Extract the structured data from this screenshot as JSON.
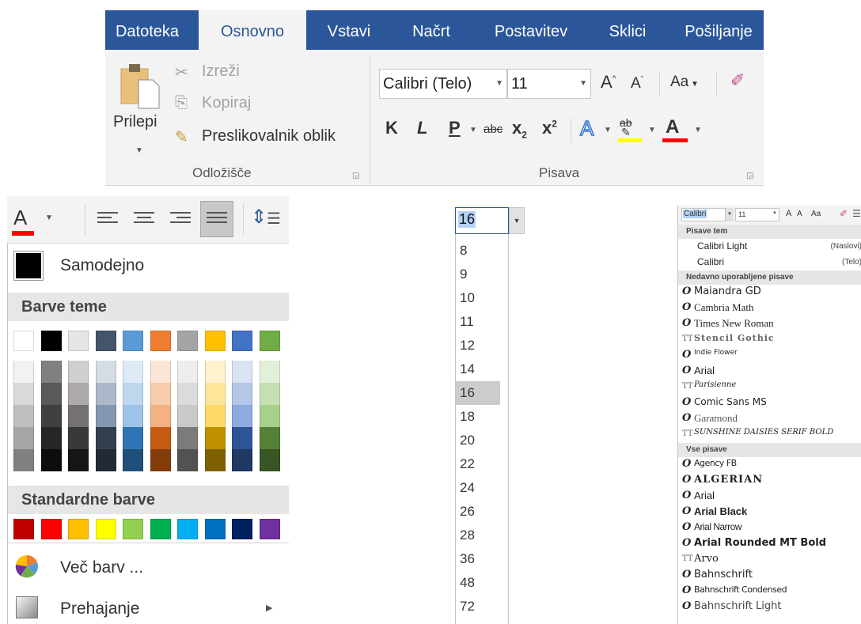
{
  "ribbon": {
    "tabs": [
      "Datoteka",
      "Osnovno",
      "Vstavi",
      "Načrt",
      "Postavitev",
      "Sklici",
      "Pošiljanje"
    ],
    "active_tab": "Osnovno",
    "clipboard": {
      "paste": "Prilepi",
      "cut": "Izreži",
      "copy": "Kopiraj",
      "format_painter": "Preslikovalnik oblik",
      "group_label": "Odložišče"
    },
    "font": {
      "font_name": "Calibri (Telo)",
      "font_size": "11",
      "grow": "A",
      "shrink": "A",
      "change_case": "Aa",
      "bold": "K",
      "italic": "L",
      "underline": "P",
      "strike": "abc",
      "subscript": "x",
      "superscript": "x",
      "sub_mark": "2",
      "sup_mark": "2",
      "text_effects": "A",
      "highlight": "ab",
      "font_color": "A",
      "group_label": "Pisava"
    }
  },
  "color_picker": {
    "automatic": "Samodejno",
    "theme_header": "Barve teme",
    "standard_header": "Standardne barve",
    "more_colors": "Več barv ...",
    "gradient": "Prehajanje",
    "font_color_letter": "A",
    "theme_top": [
      "#ffffff",
      "#000000",
      "#e7e6e6",
      "#44546a",
      "#5b9bd5",
      "#ed7d31",
      "#a5a5a5",
      "#ffc000",
      "#4472c4",
      "#70ad47"
    ],
    "theme_shades": [
      [
        "#f2f2f2",
        "#d9d9d9",
        "#bfbfbf",
        "#a6a6a6",
        "#808080"
      ],
      [
        "#808080",
        "#595959",
        "#404040",
        "#262626",
        "#0d0d0d"
      ],
      [
        "#d0cece",
        "#aeaaaa",
        "#757171",
        "#3a3838",
        "#171616"
      ],
      [
        "#d6dce4",
        "#adb9ca",
        "#8497b0",
        "#333f4f",
        "#222a35"
      ],
      [
        "#deebf6",
        "#bdd7ee",
        "#9dc3e6",
        "#2e75b5",
        "#1f4e79"
      ],
      [
        "#fbe5d5",
        "#f7cbac",
        "#f4b183",
        "#c55a11",
        "#843c0b"
      ],
      [
        "#ededed",
        "#dbdbdb",
        "#c9c9c9",
        "#7b7b7b",
        "#525252"
      ],
      [
        "#fff2cc",
        "#fee599",
        "#ffd965",
        "#bf9000",
        "#7f6000"
      ],
      [
        "#dae3f3",
        "#b4c7e7",
        "#8faadc",
        "#2f5496",
        "#1f3864"
      ],
      [
        "#e2efd9",
        "#c5e0b3",
        "#a8d08d",
        "#538135",
        "#375623"
      ]
    ],
    "standard": [
      "#c00000",
      "#ff0000",
      "#ffc000",
      "#ffff00",
      "#92d050",
      "#00b050",
      "#00b0f0",
      "#0070c0",
      "#002060",
      "#7030a0"
    ]
  },
  "font_size_list": {
    "current": "16",
    "sizes": [
      "8",
      "9",
      "10",
      "11",
      "12",
      "14",
      "16",
      "18",
      "20",
      "22",
      "24",
      "26",
      "28",
      "36",
      "48",
      "72"
    ],
    "selected": "16"
  },
  "font_list": {
    "current_font": "Calibri",
    "current_size": "11",
    "grow": "A",
    "shrink": "A",
    "change_case": "Aa",
    "theme_header": "Pisave tem",
    "theme_fonts": [
      {
        "name": "Calibri Light",
        "tag": "(Naslovi)"
      },
      {
        "name": "Calibri",
        "tag": "(Telo)"
      }
    ],
    "recent_header": "Nedavno uporabljene pisave",
    "recent_fonts": [
      {
        "name": "Maiandra GD",
        "icon": "O"
      },
      {
        "name": "Cambria Math",
        "icon": "O"
      },
      {
        "name": "Times New Roman",
        "icon": "O"
      },
      {
        "name": "Stencil Gothic",
        "icon": "TT"
      },
      {
        "name": "Indie Flower",
        "icon": "O"
      },
      {
        "name": "Arial",
        "icon": "O"
      },
      {
        "name": "Parisienne",
        "icon": "TT"
      },
      {
        "name": "Comic Sans MS",
        "icon": "O"
      },
      {
        "name": "Garamond",
        "icon": "O"
      },
      {
        "name": "SUNSHINE DAISIES SERIF BOLD",
        "icon": "TT"
      }
    ],
    "all_header": "Vse pisave",
    "all_fonts": [
      {
        "name": "Agency FB",
        "icon": "O"
      },
      {
        "name": "ALGERIAN",
        "icon": "O"
      },
      {
        "name": "Arial",
        "icon": "O"
      },
      {
        "name": "Arial Black",
        "icon": "O"
      },
      {
        "name": "Arial Narrow",
        "icon": "O"
      },
      {
        "name": "Arial Rounded MT Bold",
        "icon": "O"
      },
      {
        "name": "Arvo",
        "icon": "TT"
      },
      {
        "name": "Bahnschrift",
        "icon": "O"
      },
      {
        "name": "Bahnschrift Condensed",
        "icon": "O"
      },
      {
        "name": "Bahnschrift Light",
        "icon": "O"
      }
    ]
  },
  "colors": {
    "brand": "#2b579a",
    "ribbon_bg": "#f3f3f3",
    "highlight_yellow": "#ffff00",
    "font_red": "#ff0000"
  }
}
